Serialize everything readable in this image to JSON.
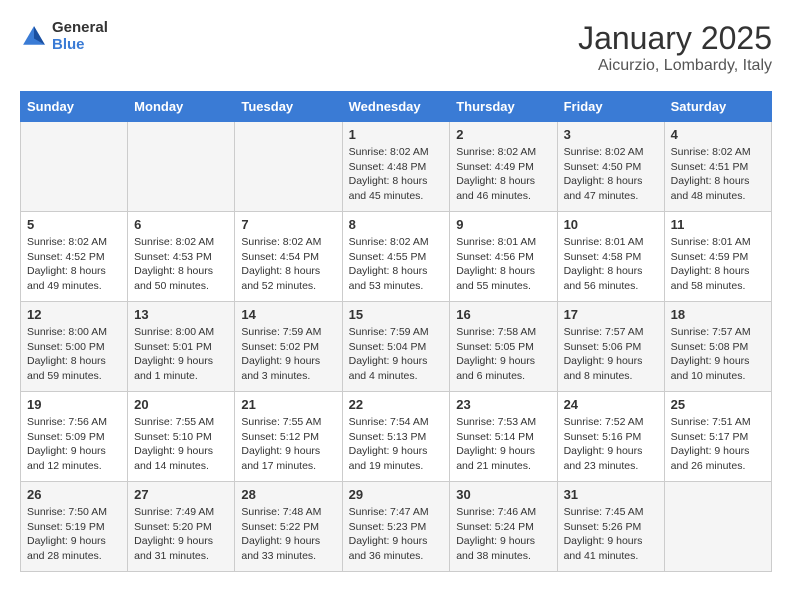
{
  "header": {
    "logo_general": "General",
    "logo_blue": "Blue",
    "title": "January 2025",
    "subtitle": "Aicurzio, Lombardy, Italy"
  },
  "days_of_week": [
    "Sunday",
    "Monday",
    "Tuesday",
    "Wednesday",
    "Thursday",
    "Friday",
    "Saturday"
  ],
  "weeks": [
    [
      {
        "day": "",
        "info": ""
      },
      {
        "day": "",
        "info": ""
      },
      {
        "day": "",
        "info": ""
      },
      {
        "day": "1",
        "info": "Sunrise: 8:02 AM\nSunset: 4:48 PM\nDaylight: 8 hours\nand 45 minutes."
      },
      {
        "day": "2",
        "info": "Sunrise: 8:02 AM\nSunset: 4:49 PM\nDaylight: 8 hours\nand 46 minutes."
      },
      {
        "day": "3",
        "info": "Sunrise: 8:02 AM\nSunset: 4:50 PM\nDaylight: 8 hours\nand 47 minutes."
      },
      {
        "day": "4",
        "info": "Sunrise: 8:02 AM\nSunset: 4:51 PM\nDaylight: 8 hours\nand 48 minutes."
      }
    ],
    [
      {
        "day": "5",
        "info": "Sunrise: 8:02 AM\nSunset: 4:52 PM\nDaylight: 8 hours\nand 49 minutes."
      },
      {
        "day": "6",
        "info": "Sunrise: 8:02 AM\nSunset: 4:53 PM\nDaylight: 8 hours\nand 50 minutes."
      },
      {
        "day": "7",
        "info": "Sunrise: 8:02 AM\nSunset: 4:54 PM\nDaylight: 8 hours\nand 52 minutes."
      },
      {
        "day": "8",
        "info": "Sunrise: 8:02 AM\nSunset: 4:55 PM\nDaylight: 8 hours\nand 53 minutes."
      },
      {
        "day": "9",
        "info": "Sunrise: 8:01 AM\nSunset: 4:56 PM\nDaylight: 8 hours\nand 55 minutes."
      },
      {
        "day": "10",
        "info": "Sunrise: 8:01 AM\nSunset: 4:58 PM\nDaylight: 8 hours\nand 56 minutes."
      },
      {
        "day": "11",
        "info": "Sunrise: 8:01 AM\nSunset: 4:59 PM\nDaylight: 8 hours\nand 58 minutes."
      }
    ],
    [
      {
        "day": "12",
        "info": "Sunrise: 8:00 AM\nSunset: 5:00 PM\nDaylight: 8 hours\nand 59 minutes."
      },
      {
        "day": "13",
        "info": "Sunrise: 8:00 AM\nSunset: 5:01 PM\nDaylight: 9 hours\nand 1 minute."
      },
      {
        "day": "14",
        "info": "Sunrise: 7:59 AM\nSunset: 5:02 PM\nDaylight: 9 hours\nand 3 minutes."
      },
      {
        "day": "15",
        "info": "Sunrise: 7:59 AM\nSunset: 5:04 PM\nDaylight: 9 hours\nand 4 minutes."
      },
      {
        "day": "16",
        "info": "Sunrise: 7:58 AM\nSunset: 5:05 PM\nDaylight: 9 hours\nand 6 minutes."
      },
      {
        "day": "17",
        "info": "Sunrise: 7:57 AM\nSunset: 5:06 PM\nDaylight: 9 hours\nand 8 minutes."
      },
      {
        "day": "18",
        "info": "Sunrise: 7:57 AM\nSunset: 5:08 PM\nDaylight: 9 hours\nand 10 minutes."
      }
    ],
    [
      {
        "day": "19",
        "info": "Sunrise: 7:56 AM\nSunset: 5:09 PM\nDaylight: 9 hours\nand 12 minutes."
      },
      {
        "day": "20",
        "info": "Sunrise: 7:55 AM\nSunset: 5:10 PM\nDaylight: 9 hours\nand 14 minutes."
      },
      {
        "day": "21",
        "info": "Sunrise: 7:55 AM\nSunset: 5:12 PM\nDaylight: 9 hours\nand 17 minutes."
      },
      {
        "day": "22",
        "info": "Sunrise: 7:54 AM\nSunset: 5:13 PM\nDaylight: 9 hours\nand 19 minutes."
      },
      {
        "day": "23",
        "info": "Sunrise: 7:53 AM\nSunset: 5:14 PM\nDaylight: 9 hours\nand 21 minutes."
      },
      {
        "day": "24",
        "info": "Sunrise: 7:52 AM\nSunset: 5:16 PM\nDaylight: 9 hours\nand 23 minutes."
      },
      {
        "day": "25",
        "info": "Sunrise: 7:51 AM\nSunset: 5:17 PM\nDaylight: 9 hours\nand 26 minutes."
      }
    ],
    [
      {
        "day": "26",
        "info": "Sunrise: 7:50 AM\nSunset: 5:19 PM\nDaylight: 9 hours\nand 28 minutes."
      },
      {
        "day": "27",
        "info": "Sunrise: 7:49 AM\nSunset: 5:20 PM\nDaylight: 9 hours\nand 31 minutes."
      },
      {
        "day": "28",
        "info": "Sunrise: 7:48 AM\nSunset: 5:22 PM\nDaylight: 9 hours\nand 33 minutes."
      },
      {
        "day": "29",
        "info": "Sunrise: 7:47 AM\nSunset: 5:23 PM\nDaylight: 9 hours\nand 36 minutes."
      },
      {
        "day": "30",
        "info": "Sunrise: 7:46 AM\nSunset: 5:24 PM\nDaylight: 9 hours\nand 38 minutes."
      },
      {
        "day": "31",
        "info": "Sunrise: 7:45 AM\nSunset: 5:26 PM\nDaylight: 9 hours\nand 41 minutes."
      },
      {
        "day": "",
        "info": ""
      }
    ]
  ]
}
